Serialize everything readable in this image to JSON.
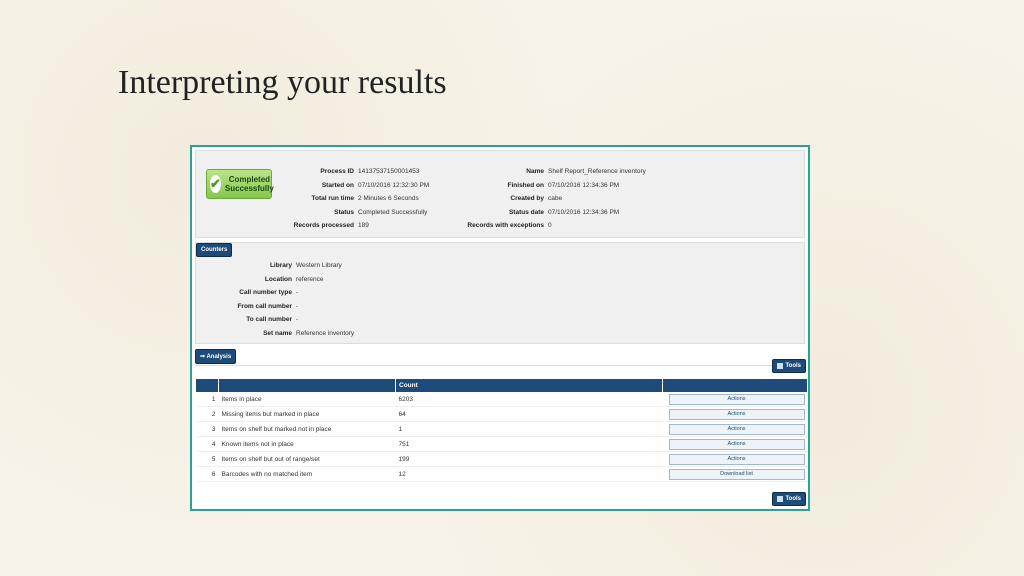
{
  "slide": {
    "title": "Interpreting your results"
  },
  "status": {
    "badge_line1": "Completed",
    "badge_line2": "Successfully"
  },
  "summary_left": [
    {
      "label": "Process ID",
      "value": "1413753715000145​3"
    },
    {
      "label": "Started on",
      "value": "07/10/2016 12:32:30 PM"
    },
    {
      "label": "Total run time",
      "value": "2 Minutes 6 Seconds"
    },
    {
      "label": "Status",
      "value": "Completed Successfully"
    },
    {
      "label": "Records processed",
      "value": "189"
    }
  ],
  "summary_right": [
    {
      "label": "Name",
      "value": "Shelf Report_Reference inventory"
    },
    {
      "label": "Finished on",
      "value": "07/10/2016 12:34:36 PM"
    },
    {
      "label": "Created by",
      "value": "cabe"
    },
    {
      "label": "Status date",
      "value": "07/10/2016 12:34:36 PM"
    },
    {
      "label": "Records with exceptions",
      "value": "0"
    }
  ],
  "counters": {
    "button_label": "Counters",
    "fields": [
      {
        "label": "Library",
        "value": "Western Library"
      },
      {
        "label": "Location",
        "value": "reference"
      },
      {
        "label": "Call number type",
        "value": "-"
      },
      {
        "label": "From call number",
        "value": "-"
      },
      {
        "label": "To call number",
        "value": "-"
      },
      {
        "label": "Set name",
        "value": "Reference inventory"
      }
    ]
  },
  "analysis": {
    "button_label": "⇒ Analysis",
    "tools_label": "Tools"
  },
  "table": {
    "headers": [
      "",
      "",
      "Count",
      ""
    ],
    "rows": [
      {
        "num": "1",
        "label": "Items in place",
        "count": "6203",
        "action": "Actions"
      },
      {
        "num": "2",
        "label": "Missing items but marked in place",
        "count": "64",
        "action": "Actions"
      },
      {
        "num": "3",
        "label": "Items on shelf but marked not in place",
        "count": "1",
        "action": "Actions"
      },
      {
        "num": "4",
        "label": "Known items not in place",
        "count": "751",
        "action": "Actions"
      },
      {
        "num": "5",
        "label": "Items on shelf but out of range/set",
        "count": "199",
        "action": "Actions"
      },
      {
        "num": "6",
        "label": "Barcodes with no matched item",
        "count": "12",
        "action": "Download list"
      }
    ]
  },
  "colors": {
    "accent": "#1e4b7a",
    "frame": "#2aa198",
    "success": "#86c64c"
  }
}
